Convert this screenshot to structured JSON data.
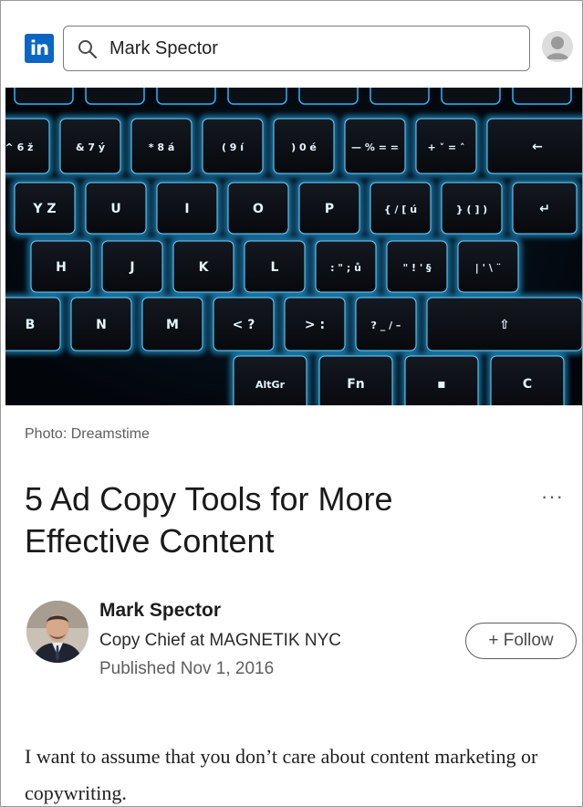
{
  "header": {
    "logo_text": "in",
    "search_value": "Mark Spector",
    "search_icon": "search-icon",
    "avatar_icon": "user-avatar-icon"
  },
  "hero": {
    "keys": {
      "row1": [
        "^ 6 ž",
        "& 7 ý",
        "* 8 á",
        "( 9 í",
        ") 0 é",
        "— % = =",
        "+ ˅ = ˄",
        "←"
      ],
      "row2": [
        "Y Z",
        "U",
        "I",
        "O",
        "P",
        "{ / [ ú",
        "} ( ] )",
        "↵"
      ],
      "row3": [
        "H",
        "J",
        "K",
        "L",
        ": \" ; ů",
        "\" ! ' §",
        "| ' \\ ¨"
      ],
      "row4": [
        "B",
        "N",
        "M",
        "< ?",
        "> :",
        "? _ / –",
        "⇧"
      ],
      "row5": [
        "AltGr",
        "Fn",
        "▪",
        "C"
      ]
    }
  },
  "caption": "Photo: Dreamstime",
  "article": {
    "title": "5 Ad Copy Tools for More Effective Content",
    "more_label": "···",
    "author": {
      "name": "Mark Spector",
      "role": "Copy Chief at MAGNETIK NYC",
      "published": "Published Nov 1, 2016"
    },
    "follow_label": "+ Follow",
    "body_text": "I want to assume that you don’t care about content marketing or copywriting."
  },
  "colors": {
    "brand": "#0a66c2",
    "key_glow": "#25b8ff"
  }
}
